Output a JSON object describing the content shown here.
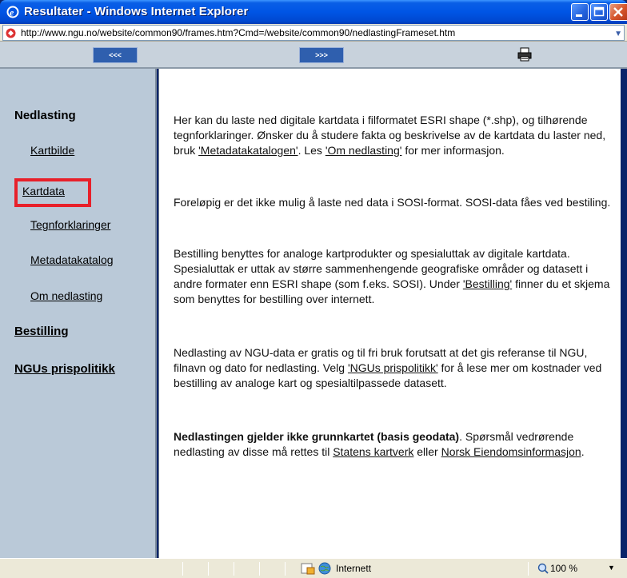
{
  "window": {
    "title": "Resultater - Windows Internet Explorer"
  },
  "address": {
    "url": "http://www.ngu.no/website/common90/frames.htm?Cmd=/website/common90/nedlastingFrameset.htm"
  },
  "toolbar": {
    "back_label": "<<<",
    "forward_label": ">>>",
    "print_icon": "printer-icon"
  },
  "sidebar": {
    "heading": "Nedlasting",
    "items": [
      {
        "label": "Kartbilde"
      },
      {
        "label": "Kartdata"
      },
      {
        "label": "Tegnforklaringer"
      },
      {
        "label": "Metadatakatalog"
      },
      {
        "label": "Om nedlasting"
      }
    ],
    "bestilling": "Bestilling",
    "prispolitikk": "NGUs prispolitikk",
    "highlight_color": "#e8202a"
  },
  "content": {
    "p1": {
      "t1": "Her kan du laste ned digitale kartdata i filformatet ESRI shape (*.shp), og tilhørende tegnforklaringer. Ønsker du å studere fakta og beskrivelse av de kartdata du laster ned, bruk ",
      "l1": "'Metadatakatalogen'",
      "t2": ". Les ",
      "l2": "'Om nedlasting'",
      "t3": " for mer informasjon."
    },
    "p2": "Foreløpig er det ikke mulig å laste ned data i SOSI-format. SOSI-data fåes ved bestiling.",
    "p3": {
      "t1": "Bestilling benyttes for analoge kartprodukter og spesialuttak av digitale kartdata. Spesialuttak er uttak av større sammenhengende geografiske områder og datasett i andre formater enn ESRI shape (som f.eks. SOSI). Under ",
      "l1": "'Bestilling'",
      "t2": " finner du et skjema som benyttes for bestilling over internett."
    },
    "p4": {
      "t1": "Nedlasting av NGU-data er gratis og til fri bruk forutsatt at det gis referanse til NGU, filnavn og dato for nedlasting. Velg ",
      "l1": "'NGUs prispolitikk'",
      "t2": " for å lese mer om kostnader ved bestilling av analoge kart og spesialtilpassede datasett."
    },
    "p5": {
      "bold": "Nedlastingen gjelder ikke grunnkartet (basis geodata)",
      "t1": ". Spørsmål vedrørende nedlasting av disse må rettes til ",
      "l1": "Statens kartverk",
      "t2": " eller ",
      "l2": "Norsk Eiendomsinformasjon",
      "t3": "."
    }
  },
  "status": {
    "zone": "Internett",
    "zoom": "100 %"
  },
  "colors": {
    "titlebar": "#0055e5",
    "sidebar_bg": "#bac9d8",
    "topframe_bg": "#c8d2dc",
    "nav_button": "#2f5fae"
  }
}
